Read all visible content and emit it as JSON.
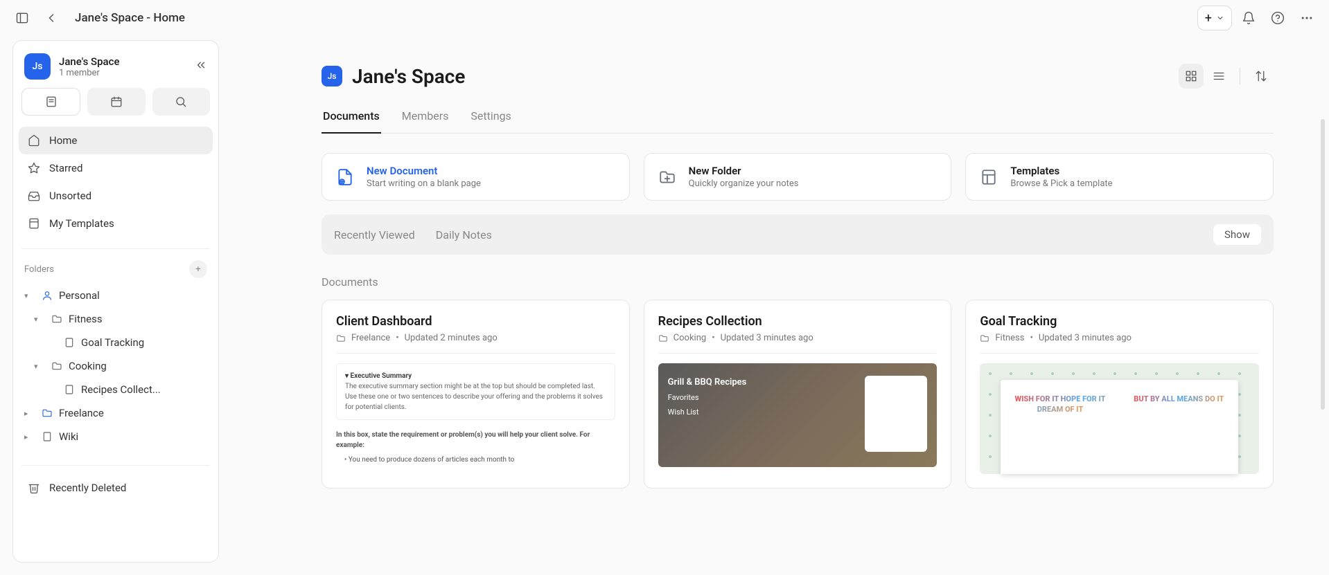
{
  "topbar": {
    "title": "Jane's Space - Home"
  },
  "workspace": {
    "initials": "Js",
    "name": "Jane's Space",
    "subtitle": "1 member"
  },
  "nav": {
    "home": "Home",
    "starred": "Starred",
    "unsorted": "Unsorted",
    "templates": "My Templates"
  },
  "folders": {
    "heading": "Folders",
    "items": {
      "personal": "Personal",
      "fitness": "Fitness",
      "goal_tracking": "Goal Tracking",
      "cooking": "Cooking",
      "recipes": "Recipes Collect...",
      "freelance": "Freelance",
      "wiki": "Wiki"
    }
  },
  "recently_deleted": "Recently Deleted",
  "main": {
    "space_initials": "Js",
    "space_title": "Jane's Space",
    "tabs": {
      "documents": "Documents",
      "members": "Members",
      "settings": "Settings"
    },
    "actions": {
      "new_doc": {
        "title": "New Document",
        "sub": "Start writing on a blank page"
      },
      "new_folder": {
        "title": "New Folder",
        "sub": "Quickly organize your notes"
      },
      "templates": {
        "title": "Templates",
        "sub": "Browse & Pick a template"
      }
    },
    "recent": {
      "viewed": "Recently Viewed",
      "daily": "Daily Notes",
      "show": "Show"
    },
    "section": "Documents",
    "docs": [
      {
        "title": "Client Dashboard",
        "folder": "Freelance",
        "updated": "Updated 2 minutes ago",
        "preview": {
          "head": "▾   Executive Summary",
          "body": "The executive summary section might be at the top but should be completed last. Use these one or two sentences to describe your offering and the problems it solves for potential clients.",
          "req": "In this box, state the requirement or problem(s) you will help your client solve. For example:",
          "bullet": "You need to produce dozens of articles each month to"
        }
      },
      {
        "title": "Recipes Collection",
        "folder": "Cooking",
        "updated": "Updated 3 minutes ago",
        "bbq": {
          "title": "Grill & BBQ Recipes",
          "fav": "Favorites",
          "wish": "Wish List"
        }
      },
      {
        "title": "Goal Tracking",
        "folder": "Fitness",
        "updated": "Updated 3 minutes ago",
        "book": {
          "left": "WISH FOR IT HOPE FOR IT DREAM OF IT",
          "right": "BUT BY ALL MEANS DO IT"
        }
      }
    ]
  }
}
